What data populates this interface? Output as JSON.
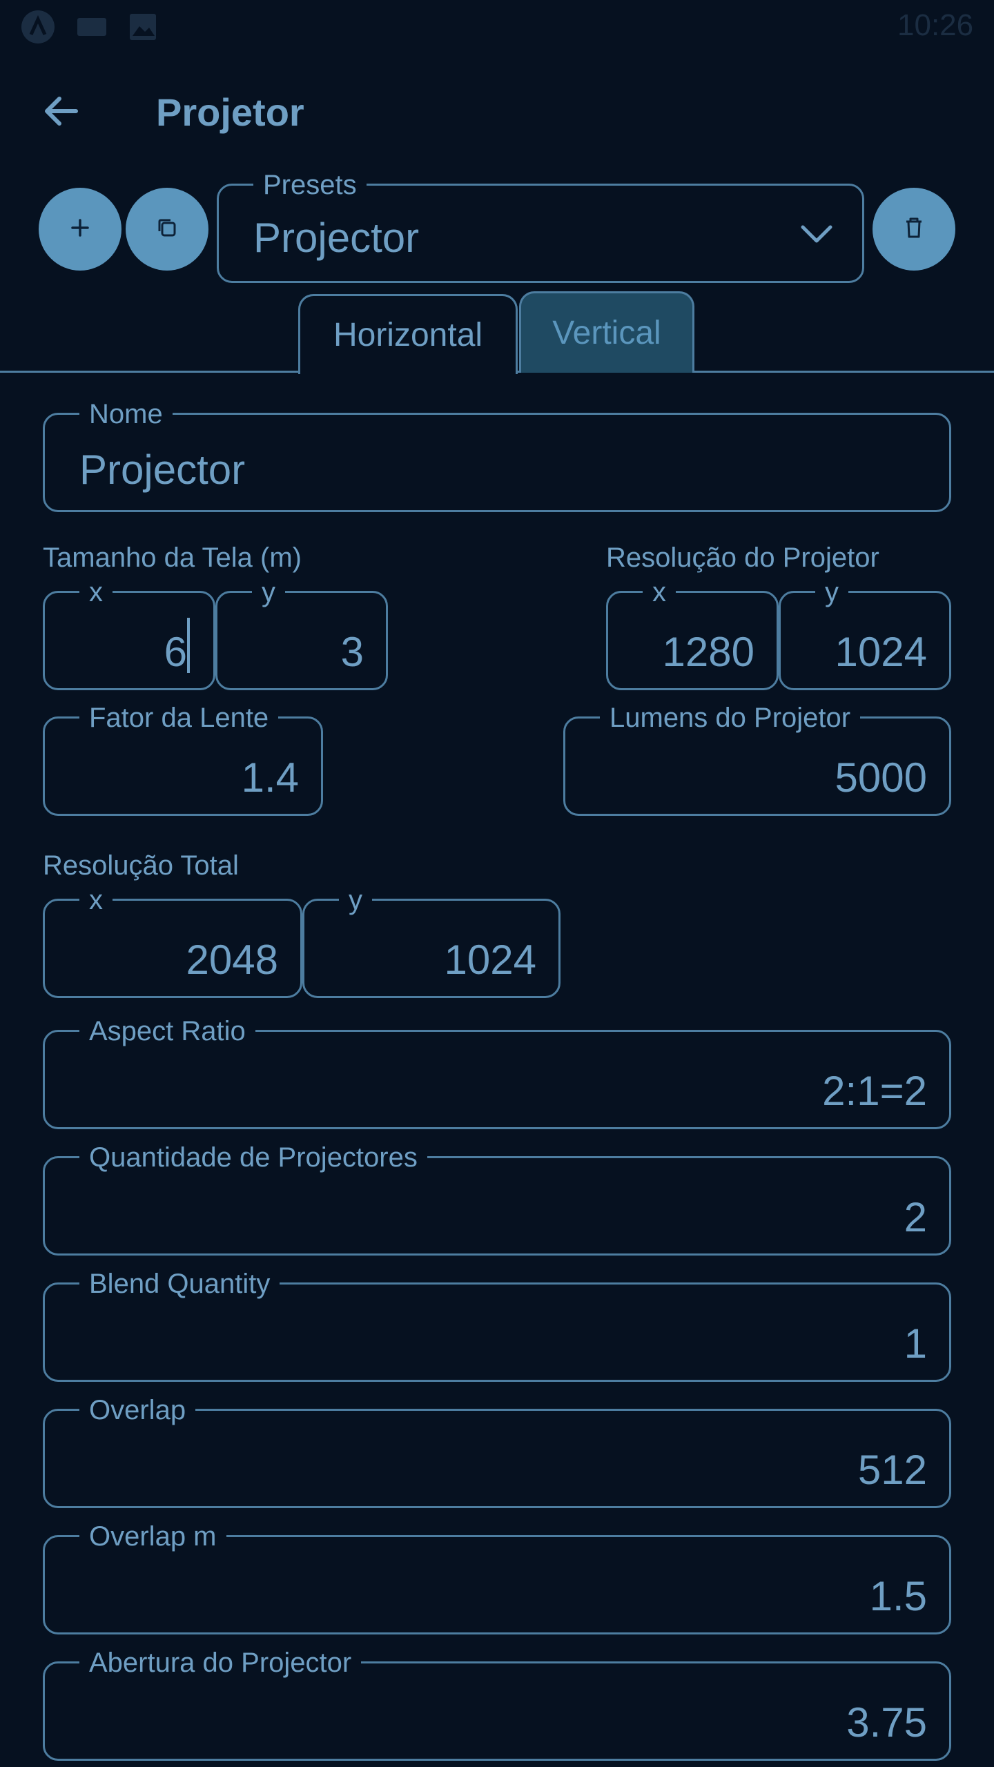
{
  "status_bar": {
    "time": "10:26",
    "icons": [
      "app-logo-icon",
      "keyboard-icon",
      "image-icon"
    ]
  },
  "app_bar": {
    "title": "Projetor",
    "back_icon": "arrow-left-icon"
  },
  "preset_bar": {
    "add_icon": "plus-icon",
    "copy_icon": "copy-icon",
    "delete_icon": "trash-icon",
    "presets_label": "Presets",
    "presets_value": "Projector"
  },
  "tabs": [
    {
      "label": "Horizontal",
      "active": true
    },
    {
      "label": "Vertical",
      "active": false
    }
  ],
  "form": {
    "nome": {
      "label": "Nome",
      "value": "Projector"
    },
    "tamanho_tela": {
      "label": "Tamanho da Tela (m)",
      "x_label": "x",
      "x_value": "6",
      "y_label": "y",
      "y_value": "3"
    },
    "resolucao_projetor": {
      "label": "Resolução do Projetor",
      "x_label": "x",
      "x_value": "1280",
      "y_label": "y",
      "y_value": "1024"
    },
    "fator_lente": {
      "label": "Fator da Lente",
      "value": "1.4"
    },
    "lumens": {
      "label": "Lumens do Projetor",
      "value": "5000"
    },
    "resolucao_total": {
      "label": "Resolução Total",
      "x_label": "x",
      "x_value": "2048",
      "y_label": "y",
      "y_value": "1024"
    },
    "aspect_ratio": {
      "label": "Aspect Ratio",
      "value": "2:1=2"
    },
    "quantidade": {
      "label": "Quantidade de Projectores",
      "value": "2"
    },
    "blend": {
      "label": "Blend Quantity",
      "value": "1"
    },
    "overlap": {
      "label": "Overlap",
      "value": "512"
    },
    "overlap_m": {
      "label": "Overlap m",
      "value": "1.5"
    },
    "abertura": {
      "label": "Abertura do Projector",
      "value": "3.75"
    }
  },
  "colors": {
    "background": "#061120",
    "accent": "#5b96bd",
    "text": "#6f9fc4",
    "border": "#4d7da0",
    "inactive_tab": "#1f4a62"
  }
}
